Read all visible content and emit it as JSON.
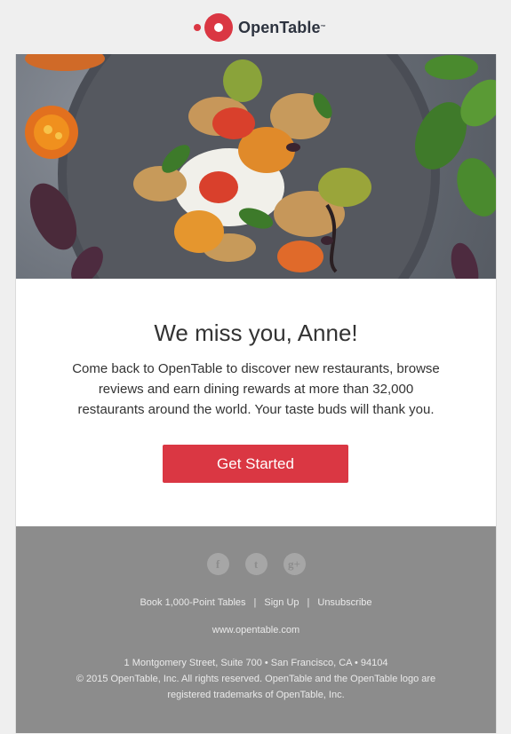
{
  "header": {
    "brand": "OpenTable",
    "brand_tm": "™",
    "brand_color": "#da3743"
  },
  "hero": {
    "icon": "food-plate-image"
  },
  "content": {
    "title": "We miss you, Anne!",
    "body": "Come back to OpenTable to discover new restaurants, browse reviews and earn dining rewards at more than 32,000 restaurants around the world. Your taste buds will thank you.",
    "cta_label": "Get Started",
    "cta_color": "#da3743"
  },
  "footer": {
    "social": [
      {
        "name": "facebook",
        "glyph": "f"
      },
      {
        "name": "twitter",
        "glyph": "t"
      },
      {
        "name": "google-plus",
        "glyph": "g+"
      }
    ],
    "links": [
      "Book 1,000-Point Tables",
      "Sign Up",
      "Unsubscribe"
    ],
    "link_separator": "|",
    "website": "www.opentable.com",
    "address_line": "1 Montgomery Street, Suite 700 • San Francisco, CA • 94104",
    "copyright_1": "© 2015 OpenTable, Inc. All rights reserved. OpenTable and the OpenTable logo are",
    "copyright_2": "registered trademarks of OpenTable, Inc.",
    "background": "#8c8c8c"
  }
}
